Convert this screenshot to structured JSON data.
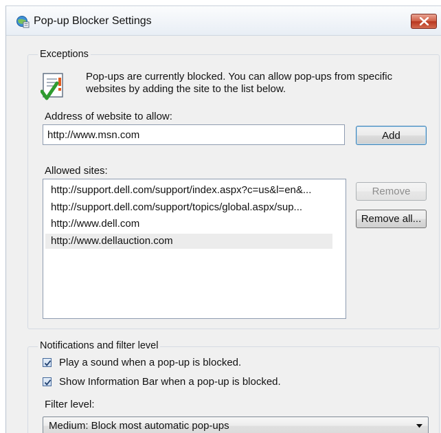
{
  "window": {
    "title": "Pop-up Blocker Settings"
  },
  "exceptions": {
    "group_label": "Exceptions",
    "info_line1": "Pop-ups are currently blocked.  You can allow pop-ups from specific",
    "info_line2": "websites by adding the site to the list below.",
    "address_label": "Address of website to allow:",
    "address_value": "http://www.msn.com",
    "add_label": "Add",
    "allowed_label": "Allowed sites:",
    "allowed_sites": [
      "http://support.dell.com/support/index.aspx?c=us&l=en&...",
      "http://support.dell.com/support/topics/global.aspx/sup...",
      "http://www.dell.com",
      "http://www.dellauction.com"
    ],
    "selected_index": 3,
    "remove_label": "Remove",
    "remove_all_label": "Remove all..."
  },
  "notifications": {
    "group_label": "Notifications and filter level",
    "sound_label": "Play a sound when a pop-up is blocked.",
    "sound_checked": true,
    "infobar_label": "Show Information Bar when a pop-up is blocked.",
    "infobar_checked": true,
    "filter_label": "Filter level:",
    "filter_value": "Medium: Block most automatic pop-ups"
  },
  "colors": {
    "accent": "#3c7fb1",
    "close": "#c7432b",
    "selection": "#ececec"
  },
  "icons": {
    "app": "ie-globe-icon",
    "close": "close-icon",
    "info": "warning-document-icon",
    "dropdown": "chevron-down-icon"
  }
}
